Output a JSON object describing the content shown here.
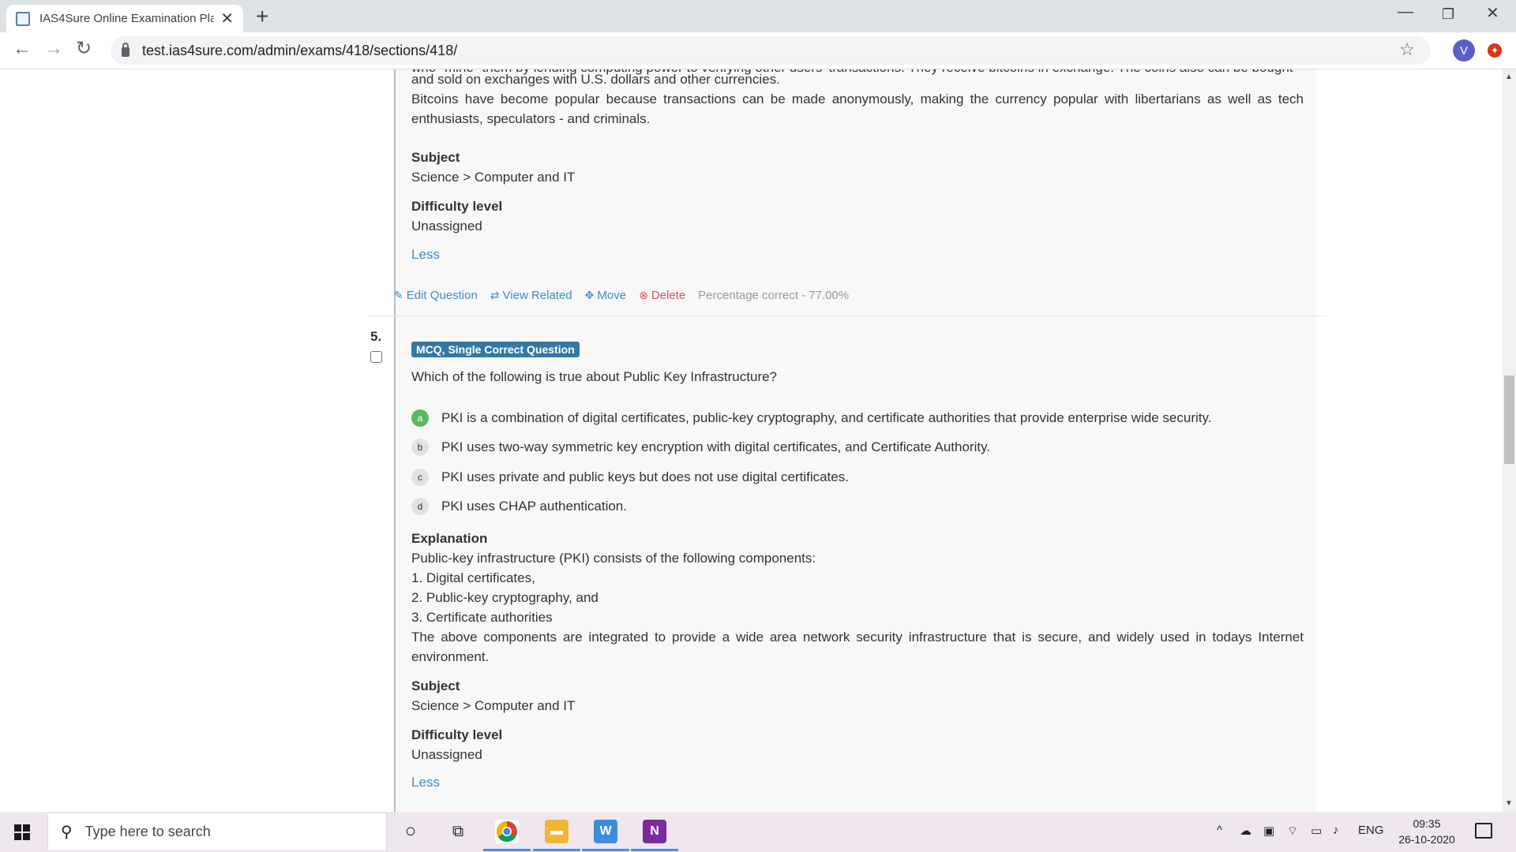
{
  "browser": {
    "tab_title": "IAS4Sure Online Examination Pla",
    "url": "test.ias4sure.com/admin/exams/418/sections/418/",
    "profile_initial": "V"
  },
  "prev_question": {
    "cut_text": "who \"mine\" them by lending computing power to verifying other users' transactions. They receive bitcoins in exchange. The coins also can be bought",
    "text_line2": "and sold on exchanges with U.S. dollars and other currencies.",
    "text_para": "Bitcoins have become popular because transactions can be made anonymously, making the currency popular with libertarians as well as tech enthusiasts, speculators - and criminals.",
    "subject_label": "Subject",
    "subject_value": "Science > Computer and IT",
    "difficulty_label": "Difficulty level",
    "difficulty_value": "Unassigned",
    "less_link": "Less",
    "actions": {
      "edit": "Edit Question",
      "view_related": "View Related",
      "move": "Move",
      "delete": "Delete",
      "percentage": "Percentage correct - 77.00%"
    }
  },
  "question5": {
    "number": "5.",
    "type_badge": "MCQ, Single Correct Question",
    "text": "Which of the following is true about Public Key Infrastructure?",
    "options": [
      {
        "letter": "a",
        "text": "PKI is a combination of digital certificates, public-key cryptography, and certificate authorities that provide enterprise wide security.",
        "correct": true
      },
      {
        "letter": "b",
        "text": "PKI uses two-way symmetric key encryption with digital certificates, and Certificate Authority.",
        "correct": false
      },
      {
        "letter": "c",
        "text": "PKI uses private and public keys but does not use digital certificates.",
        "correct": false
      },
      {
        "letter": "d",
        "text": "PKI uses CHAP authentication.",
        "correct": false
      }
    ],
    "explanation_label": "Explanation",
    "explanation_lines": [
      "Public-key infrastructure (PKI) consists of the following components:",
      "1. Digital certificates,",
      "2. Public-key cryptography, and",
      "3. Certificate authorities"
    ],
    "explanation_para": "The above components are integrated to provide a wide area network security infrastructure that is secure, and widely used in todays Internet environment.",
    "subject_label": "Subject",
    "subject_value": "Science > Computer and IT",
    "difficulty_label": "Difficulty level",
    "difficulty_value": "Unassigned",
    "less_link": "Less"
  },
  "taskbar": {
    "search_placeholder": "Type here to search",
    "language": "ENG",
    "time": "09:35",
    "date": "26-10-2020"
  }
}
